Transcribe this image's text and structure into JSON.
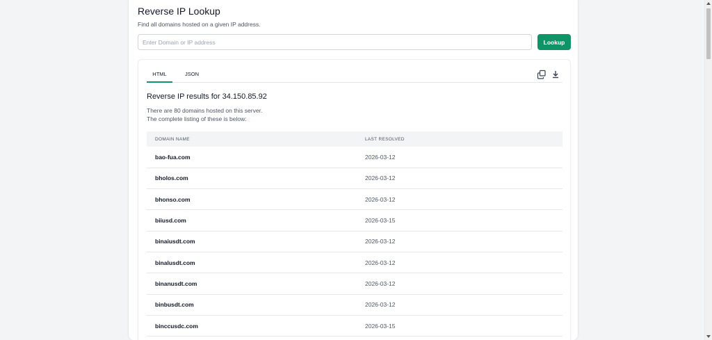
{
  "header": {
    "title": "Reverse IP Lookup",
    "subtitle": "Find all domains hosted on a given IP address."
  },
  "search": {
    "placeholder": "Enter Domain or IP address",
    "value": "",
    "button_label": "Lookup"
  },
  "tabs": [
    {
      "label": "HTML",
      "active": true
    },
    {
      "label": "JSON",
      "active": false
    }
  ],
  "icons": {
    "copy": "copy-icon",
    "download": "download-icon"
  },
  "results": {
    "heading": "Reverse IP results for 34.150.85.92",
    "desc_line1": "There are 80 domains hosted on this server.",
    "desc_line2": "The complete listing of these is below:"
  },
  "table": {
    "columns": [
      "DOMAIN NAME",
      "LAST RESOLVED"
    ],
    "rows": [
      {
        "domain": "bao-fua.com",
        "resolved": "2026-03-12"
      },
      {
        "domain": "bholos.com",
        "resolved": "2026-03-12"
      },
      {
        "domain": "bhonso.com",
        "resolved": "2026-03-12"
      },
      {
        "domain": "biiusd.com",
        "resolved": "2026-03-15"
      },
      {
        "domain": "binaiusdt.com",
        "resolved": "2026-03-12"
      },
      {
        "domain": "binalusdt.com",
        "resolved": "2026-03-12"
      },
      {
        "domain": "binanusdt.com",
        "resolved": "2026-03-12"
      },
      {
        "domain": "binbusdt.com",
        "resolved": "2026-03-12"
      },
      {
        "domain": "binccusdc.com",
        "resolved": "2026-03-15"
      }
    ]
  },
  "colors": {
    "accent": "#0e9467",
    "background": "#f3f4f6",
    "table_header_bg": "#f3f4f6"
  }
}
